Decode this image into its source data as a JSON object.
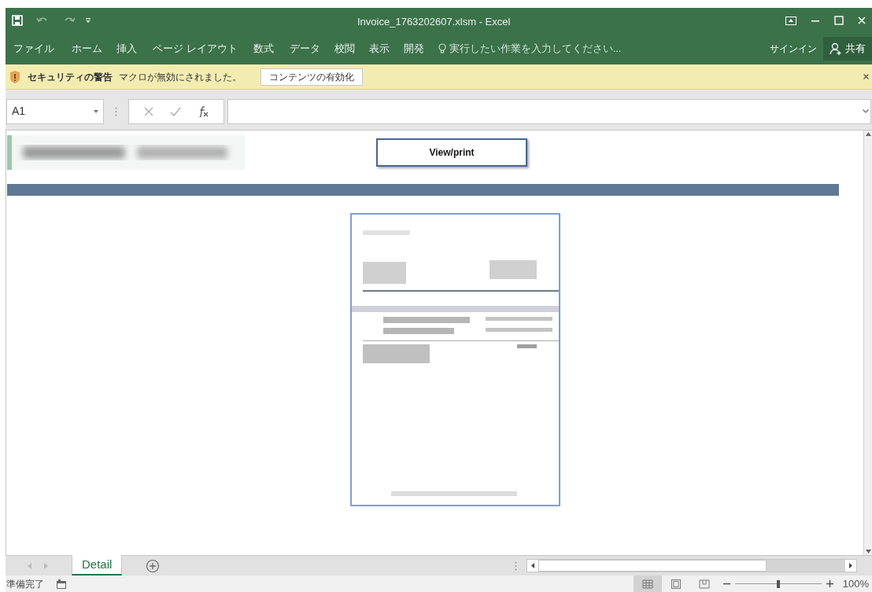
{
  "window": {
    "title": "Invoice_1763202607.xlsm - Excel"
  },
  "ribbon": {
    "tabs": [
      {
        "label": "ファイル"
      },
      {
        "label": "ホーム"
      },
      {
        "label": "挿入"
      },
      {
        "label": "ページ レイアウト"
      },
      {
        "label": "数式"
      },
      {
        "label": "データ"
      },
      {
        "label": "校閲"
      },
      {
        "label": "表示"
      },
      {
        "label": "開発"
      }
    ],
    "tell_me": {
      "placeholder": "実行したい作業を入力してください..."
    },
    "sign_in": "サインイン",
    "share": "共有"
  },
  "security_bar": {
    "title": "セキュリティの警告",
    "message": "マクロが無効にされました。",
    "button": "コンテンツの有効化"
  },
  "formula_bar": {
    "name_box": "A1"
  },
  "sheet": {
    "button": "View/print"
  },
  "sheet_tabs": [
    {
      "label": "Detail",
      "selected": true
    }
  ],
  "status_bar": {
    "status": "準備完了",
    "view_modes": [
      {
        "kind": "normal",
        "selected": true
      },
      {
        "kind": "page_layout",
        "selected": false
      },
      {
        "kind": "page_break",
        "selected": false
      }
    ],
    "zoom": {
      "level": 0.5,
      "reading": "100%"
    }
  }
}
